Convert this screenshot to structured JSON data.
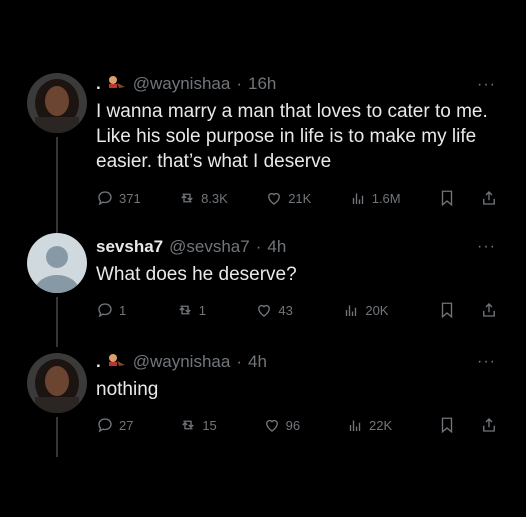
{
  "tweets": [
    {
      "name": ".",
      "handle": "@waynishaa",
      "dot": "·",
      "time": "16h",
      "text": "I wanna marry a man that loves to cater to me. Like his sole purpose in life is to make my life easier. that’s what I deserve",
      "replies": "371",
      "retweets": "8.3K",
      "likes": "21K",
      "views": "1.6M",
      "name_emoji": "drawing-emoji"
    },
    {
      "name": "sevsha7",
      "handle": "@sevsha7",
      "dot": "·",
      "time": "4h",
      "text": "What does he deserve?",
      "replies": "1",
      "retweets": "1",
      "likes": "43",
      "views": "20K"
    },
    {
      "name": ".",
      "handle": "@waynishaa",
      "dot": "·",
      "time": "4h",
      "text": "nothing",
      "replies": "27",
      "retweets": "15",
      "likes": "96",
      "views": "22K",
      "name_emoji": "drawing-emoji"
    }
  ],
  "more_label": "···",
  "colors": {
    "background": "#000000",
    "text": "#e7e9ea",
    "muted": "#71767b"
  }
}
